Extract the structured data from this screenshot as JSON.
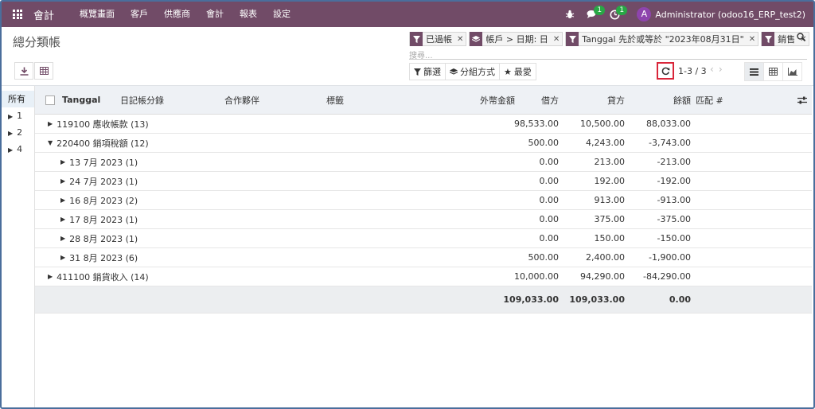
{
  "navbar": {
    "brand": "會計",
    "menu": [
      "概覽畫面",
      "客戶",
      "供應商",
      "會計",
      "報表",
      "設定"
    ],
    "messages_count": "1",
    "activities_count": "1",
    "avatar_initial": "A",
    "user": "Administrator (odoo16_ERP_test2)"
  },
  "page": {
    "title": "總分類帳"
  },
  "search": {
    "facets": [
      "已過帳",
      "帳戶 > 日期: 日",
      "Tanggal 先於或等於 \"2023年08月31日\"",
      "銷售"
    ],
    "placeholder": "搜尋..."
  },
  "tools": {
    "filter": "篩選",
    "group_by": "分組方式",
    "favorites": "最愛"
  },
  "pager": "1-3 / 3",
  "side_panel": [
    "所有",
    "1",
    "2",
    "4"
  ],
  "table": {
    "headers": {
      "date": "Tanggal",
      "journal": "日記帳分錄",
      "partner": "合作夥伴",
      "label": "標籤",
      "amount_currency": "外幣金額",
      "debit": "借方",
      "credit": "貸方",
      "balance": "餘額",
      "matching": "匹配 #"
    },
    "rows": [
      {
        "label": "119100 應收帳款 (13)",
        "level": 0,
        "expanded": false,
        "debit": "98,533.00",
        "credit": "10,500.00",
        "balance": "88,033.00"
      },
      {
        "label": "220400 銷項稅額 (12)",
        "level": 0,
        "expanded": true,
        "debit": "500.00",
        "credit": "4,243.00",
        "balance": "-3,743.00"
      },
      {
        "label": "13 7月 2023 (1)",
        "level": 1,
        "expanded": false,
        "debit": "0.00",
        "credit": "213.00",
        "balance": "-213.00"
      },
      {
        "label": "24 7月 2023 (1)",
        "level": 1,
        "expanded": false,
        "debit": "0.00",
        "credit": "192.00",
        "balance": "-192.00"
      },
      {
        "label": "16 8月 2023 (2)",
        "level": 1,
        "expanded": false,
        "debit": "0.00",
        "credit": "913.00",
        "balance": "-913.00"
      },
      {
        "label": "17 8月 2023 (1)",
        "level": 1,
        "expanded": false,
        "debit": "0.00",
        "credit": "375.00",
        "balance": "-375.00"
      },
      {
        "label": "28 8月 2023 (1)",
        "level": 1,
        "expanded": false,
        "debit": "0.00",
        "credit": "150.00",
        "balance": "-150.00"
      },
      {
        "label": "31 8月 2023 (6)",
        "level": 1,
        "expanded": false,
        "debit": "500.00",
        "credit": "2,400.00",
        "balance": "-1,900.00"
      },
      {
        "label": "411100 銷貨收入 (14)",
        "level": 0,
        "expanded": false,
        "debit": "10,000.00",
        "credit": "94,290.00",
        "balance": "-84,290.00"
      }
    ],
    "totals": {
      "debit": "109,033.00",
      "credit": "109,033.00",
      "balance": "0.00"
    }
  },
  "colors": {
    "navbar": "#714b67",
    "highlight": "#d9263a",
    "badge": "#28a745"
  }
}
